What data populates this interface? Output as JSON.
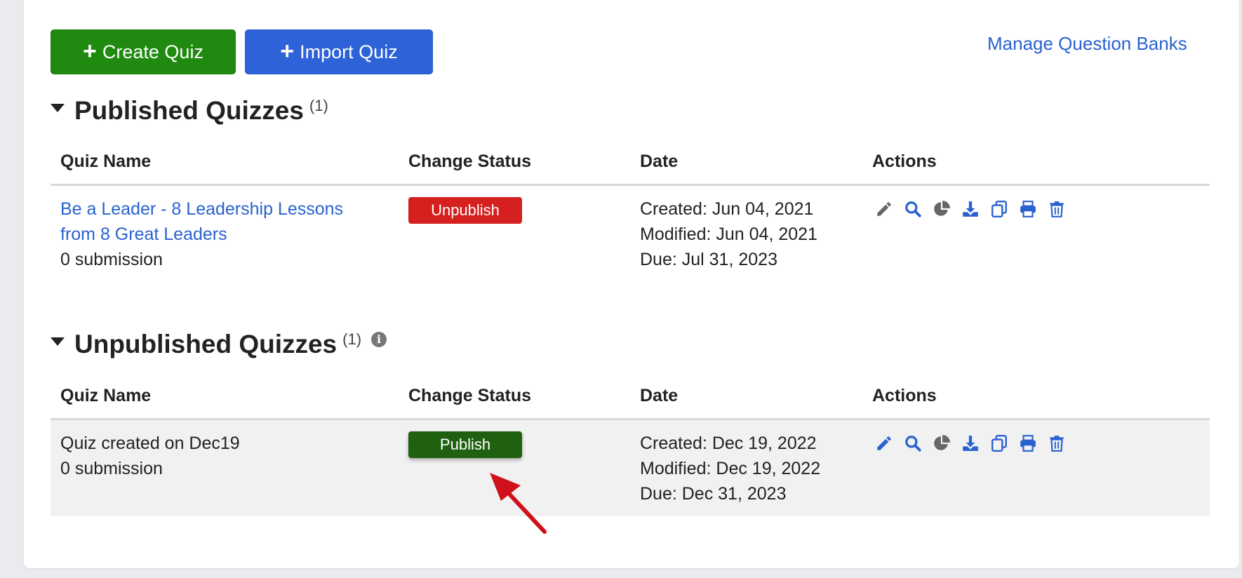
{
  "toolbar": {
    "create_label": "Create Quiz",
    "import_label": "Import Quiz",
    "manage_link": "Manage Question Banks"
  },
  "published": {
    "title": "Published Quizzes",
    "count": "(1)",
    "columns": [
      "Quiz Name",
      "Change Status",
      "Date",
      "Actions"
    ],
    "rows": [
      {
        "name_line1": "Be a Leader - 8 Leadership Lessons",
        "name_line2": "from 8 Great Leaders",
        "submissions": "0 submission",
        "status_label": "Unpublish",
        "created": "Created: Jun 04, 2021",
        "modified": "Modified: Jun 04, 2021",
        "due": "Due: Jul 31, 2023"
      }
    ]
  },
  "unpublished": {
    "title": "Unpublished Quizzes",
    "count": "(1)",
    "columns": [
      "Quiz Name",
      "Change Status",
      "Date",
      "Actions"
    ],
    "rows": [
      {
        "name": "Quiz created on Dec19",
        "submissions": "0 submission",
        "status_label": "Publish",
        "created": "Created: Dec 19, 2022",
        "modified": "Modified: Dec 19, 2022",
        "due": "Due: Dec 31, 2023"
      }
    ]
  },
  "action_icons": [
    "pencil-icon",
    "search-icon",
    "pie-chart-icon",
    "download-icon",
    "copy-icon",
    "print-icon",
    "trash-icon"
  ],
  "colors": {
    "create": "#1f8a0f",
    "import": "#2d62d8",
    "link": "#2962d0",
    "unpublish": "#d61f1f",
    "publish": "#1f6110",
    "annotation_arrow": "#d0101a"
  }
}
